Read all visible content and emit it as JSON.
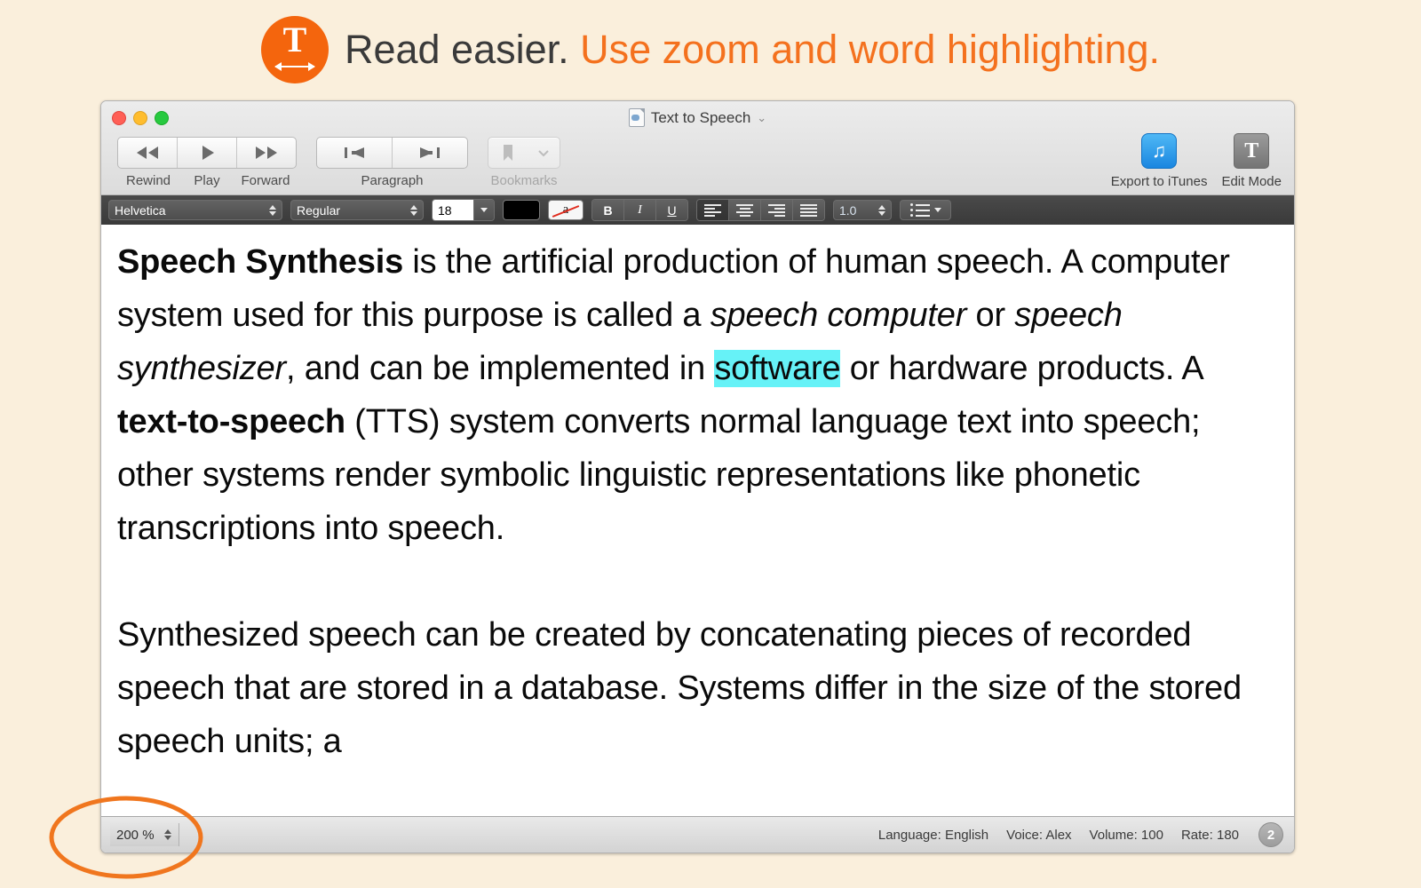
{
  "banner": {
    "icon": "tts-app-icon",
    "text_dark": "Read easier.",
    "text_accent": "Use zoom and word highlighting.",
    "accent_color": "#f4711e",
    "background_color": "#faefdc"
  },
  "window": {
    "title": "Text to Speech",
    "title_icon": "document-icon",
    "title_chevron": "⌄",
    "traffic_lights": [
      "close",
      "minimize",
      "zoom"
    ]
  },
  "toolbar": {
    "groups": [
      {
        "caption": "",
        "buttons": [
          {
            "name": "rewind",
            "label": "Rewind",
            "icon": "rewind-icon"
          },
          {
            "name": "play",
            "label": "Play",
            "icon": "play-icon"
          },
          {
            "name": "forward",
            "label": "Forward",
            "icon": "forward-icon"
          }
        ]
      },
      {
        "caption": "Paragraph",
        "buttons": [
          {
            "name": "previous-paragraph",
            "icon": "previous-paragraph-icon"
          },
          {
            "name": "next-paragraph",
            "icon": "next-paragraph-icon"
          }
        ]
      },
      {
        "caption": "Bookmarks",
        "disabled": true,
        "buttons": [
          {
            "name": "bookmark",
            "icon": "bookmark-icon"
          },
          {
            "name": "bookmark-menu",
            "icon": "chevron-down-icon"
          }
        ]
      }
    ],
    "rewind_label": "Rewind",
    "play_label": "Play",
    "forward_label": "Forward",
    "paragraph_label": "Paragraph",
    "bookmarks_label": "Bookmarks",
    "export_label": "Export to iTunes",
    "export_icon": "itunes-note-icon",
    "edit_mode_label": "Edit Mode",
    "edit_mode_icon": "edit-mode-t-icon"
  },
  "format_bar": {
    "font_family": "Helvetica",
    "font_style": "Regular",
    "font_size": "18",
    "text_color": "#000000",
    "highlight_glyph": "a",
    "bold_label": "B",
    "italic_label": "I",
    "underline_label": "U",
    "line_spacing": "1.0",
    "alignments": [
      "align-left",
      "align-center",
      "align-right",
      "align-justify"
    ],
    "selected_alignment": "align-left",
    "list_icon": "bullet-list-icon"
  },
  "document": {
    "paragraph1": {
      "bold_lead": "Speech Synthesis",
      "t1": " is the artificial production of human speech. A computer system used for this purpose is called a ",
      "i1": "speech computer",
      "t2": " or ",
      "i2": "speech synthesizer",
      "t3": ", and can be implemented in ",
      "highlight": "software",
      "t4": " or hardware products. A ",
      "bold2": "text-to-speech",
      "t5": " (TTS) system converts normal language text into speech; other systems render symbolic linguistic representations like phonetic transcriptions into speech."
    },
    "paragraph2": "Synthesized speech can be created by concatenating pieces of recorded speech that are stored in a database. Systems differ in the size of the stored speech units; a",
    "highlight_color": "#66f2f7"
  },
  "status_bar": {
    "zoom_value": "200 %",
    "language": "Language: English",
    "voice": "Voice: Alex",
    "volume": "Volume: 100",
    "rate": "Rate: 180",
    "page_number": "2"
  },
  "annotation": {
    "target": "zoom-control",
    "shape": "ellipse",
    "color": "#f0761e"
  }
}
